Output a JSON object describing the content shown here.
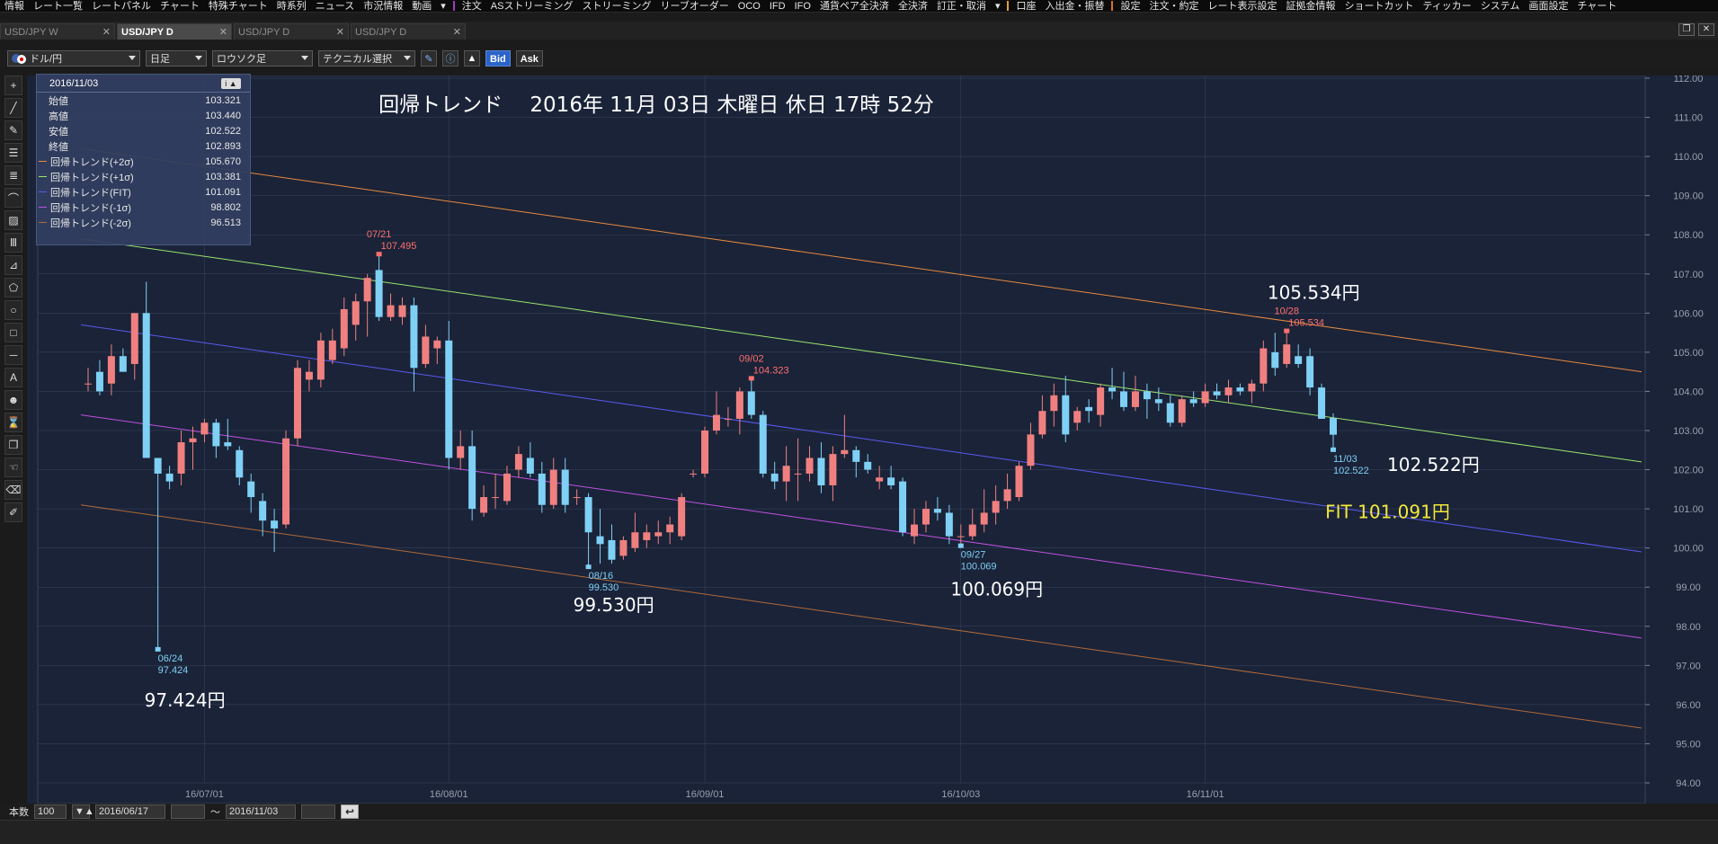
{
  "menu": {
    "items": [
      "情報",
      "レート一覧",
      "レートパネル",
      "チャート",
      "特殊チャート",
      "時系列",
      "ニュース",
      "市況情報",
      "動画",
      "▾",
      "注文",
      "ASストリーミング",
      "ストリーミング",
      "リーブオーダー",
      "OCO",
      "IFD",
      "IFO",
      "通貨ペア全決済",
      "全決済",
      "訂正・取消",
      "▾",
      "口座",
      "入出金・振替",
      "設定",
      "注文・約定",
      "レート表示設定",
      "証拠金情報",
      "ショートカット",
      "ティッカー",
      "システム",
      "画面設定",
      "チャート"
    ]
  },
  "tabs": [
    {
      "label": "USD/JPY W",
      "close": "✕"
    },
    {
      "label": "USD/JPY D",
      "close": "✕"
    },
    {
      "label": "USD/JPY D",
      "close": "✕"
    },
    {
      "label": "USD/JPY D",
      "close": "✕"
    }
  ],
  "toolbar": {
    "pair": "ドル/円",
    "period": "日足",
    "charttype": "ロウソク足",
    "technical": "テクニカル選択",
    "bid": "Bid",
    "ask": "Ask"
  },
  "tools": [
    "+",
    "╱",
    "✎",
    "☰",
    "≣",
    "⌒",
    "▨",
    "Ⅲ",
    "⊿",
    "⬠",
    "○",
    "□",
    "─",
    "A",
    "☻",
    "⌛",
    "❐",
    "☜",
    "⌫",
    "✐"
  ],
  "info_panel": {
    "date": "2016/11/03",
    "header_button": "i ▲",
    "rows": [
      {
        "label": "始値",
        "value": "103.321",
        "color": ""
      },
      {
        "label": "高値",
        "value": "103.440",
        "color": ""
      },
      {
        "label": "安値",
        "value": "102.522",
        "color": ""
      },
      {
        "label": "終値",
        "value": "102.893",
        "color": ""
      },
      {
        "label": "回帰トレンド(+2σ)",
        "value": "105.670",
        "color": "#e8893e"
      },
      {
        "label": "回帰トレンド(+1σ)",
        "value": "103.381",
        "color": "#9be36b"
      },
      {
        "label": "回帰トレンド(FIT)",
        "value": "101.091",
        "color": "#5a5af0"
      },
      {
        "label": "回帰トレンド(-1σ)",
        "value": "98.802",
        "color": "#c050e0"
      },
      {
        "label": "回帰トレンド(-2σ)",
        "value": "96.513",
        "color": "#b06a3a"
      }
    ]
  },
  "chart_data": {
    "type": "candlestick",
    "title": "回帰トレンド　 2016年 11月 03日 木曜日 休日 17時 52分",
    "y_ticks": [
      "112.00",
      "111.00",
      "110.00",
      "109.00",
      "108.00",
      "107.00",
      "106.00",
      "105.00",
      "104.00",
      "103.00",
      "102.00",
      "101.00",
      "100.00",
      "99.00",
      "98.00",
      "97.00",
      "96.00",
      "95.00",
      "94.00"
    ],
    "ylim": [
      94,
      112
    ],
    "x_ticks": [
      "16/07/01",
      "16/08/01",
      "16/09/01",
      "16/10/03",
      "16/11/01"
    ],
    "colors": {
      "up": "#f08080",
      "down": "#7fd0f5",
      "background": "#1a2338",
      "grid": "#3b465e",
      "axis_text": "#9aa0ad",
      "annotation_up": "#ff7070",
      "annotation_down": "#7fd0f5"
    },
    "candles": [
      [
        104.2,
        104.6,
        104.0,
        104.2
      ],
      [
        104.5,
        104.8,
        103.9,
        104.0
      ],
      [
        104.2,
        105.2,
        103.9,
        104.9
      ],
      [
        104.9,
        105.1,
        104.5,
        104.5
      ],
      [
        104.7,
        106.0,
        104.3,
        106.0
      ],
      [
        106.0,
        106.8,
        103.0,
        102.3
      ],
      [
        102.3,
        102.3,
        97.424,
        101.9
      ],
      [
        101.9,
        102.1,
        101.5,
        101.7
      ],
      [
        101.9,
        103.0,
        101.6,
        102.7
      ],
      [
        102.7,
        103.1,
        102.0,
        102.8
      ],
      [
        102.9,
        103.3,
        102.7,
        103.2
      ],
      [
        103.2,
        103.3,
        102.3,
        102.6
      ],
      [
        102.7,
        103.3,
        102.5,
        102.6
      ],
      [
        102.5,
        102.6,
        101.6,
        101.8
      ],
      [
        101.7,
        101.9,
        100.9,
        101.3
      ],
      [
        101.2,
        101.4,
        100.3,
        100.7
      ],
      [
        100.7,
        101.0,
        99.9,
        100.5
      ],
      [
        100.6,
        103.0,
        100.5,
        102.8
      ],
      [
        102.8,
        104.8,
        102.6,
        104.6
      ],
      [
        104.3,
        104.8,
        104.0,
        104.5
      ],
      [
        104.3,
        105.5,
        104.1,
        105.3
      ],
      [
        104.8,
        105.6,
        104.7,
        105.3
      ],
      [
        105.1,
        106.4,
        104.9,
        106.1
      ],
      [
        105.7,
        106.5,
        105.3,
        106.3
      ],
      [
        106.3,
        107.0,
        105.4,
        106.9
      ],
      [
        107.1,
        107.495,
        105.8,
        105.9
      ],
      [
        105.9,
        106.5,
        105.8,
        106.2
      ],
      [
        105.9,
        106.4,
        105.7,
        106.2
      ],
      [
        106.2,
        106.4,
        104.0,
        104.6
      ],
      [
        104.7,
        105.7,
        104.6,
        105.4
      ],
      [
        105.1,
        105.4,
        104.7,
        105.3
      ],
      [
        105.3,
        105.8,
        102.0,
        102.3
      ],
      [
        102.3,
        103.0,
        102.0,
        102.6
      ],
      [
        102.6,
        103.0,
        100.7,
        101.0
      ],
      [
        100.9,
        101.6,
        100.8,
        101.3
      ],
      [
        101.3,
        101.9,
        101.0,
        101.3
      ],
      [
        101.2,
        102.1,
        101.1,
        101.9
      ],
      [
        102.0,
        102.6,
        101.8,
        102.4
      ],
      [
        102.3,
        102.7,
        101.8,
        101.9
      ],
      [
        101.9,
        102.2,
        100.9,
        101.1
      ],
      [
        101.1,
        102.3,
        101.0,
        102.0
      ],
      [
        102.0,
        102.3,
        100.9,
        101.1
      ],
      [
        101.3,
        101.5,
        101.1,
        101.3
      ],
      [
        101.3,
        101.4,
        99.53,
        100.4
      ],
      [
        100.3,
        101.0,
        99.6,
        100.1
      ],
      [
        100.2,
        100.6,
        99.6,
        99.7
      ],
      [
        99.8,
        100.3,
        99.7,
        100.2
      ],
      [
        100.0,
        100.9,
        99.9,
        100.4
      ],
      [
        100.2,
        100.6,
        100.0,
        100.4
      ],
      [
        100.3,
        100.7,
        100.1,
        100.4
      ],
      [
        100.4,
        100.8,
        100.1,
        100.6
      ],
      [
        100.3,
        101.4,
        100.2,
        101.3
      ],
      [
        101.9,
        102.0,
        101.8,
        101.9
      ],
      [
        101.9,
        103.1,
        101.8,
        103.0
      ],
      [
        103.0,
        104.0,
        102.9,
        103.4
      ],
      [
        103.3,
        103.6,
        103.1,
        103.3
      ],
      [
        103.3,
        104.1,
        102.9,
        104.0
      ],
      [
        104.0,
        104.323,
        103.3,
        103.4
      ],
      [
        103.4,
        103.5,
        101.8,
        101.9
      ],
      [
        101.9,
        102.2,
        101.5,
        101.7
      ],
      [
        101.7,
        102.6,
        101.2,
        102.1
      ],
      [
        101.9,
        102.8,
        101.2,
        101.9
      ],
      [
        101.9,
        102.6,
        101.7,
        102.3
      ],
      [
        102.3,
        102.7,
        101.4,
        101.6
      ],
      [
        101.6,
        102.6,
        101.2,
        102.4
      ],
      [
        102.4,
        103.4,
        102.3,
        102.5
      ],
      [
        102.5,
        102.6,
        101.8,
        102.2
      ],
      [
        102.2,
        102.4,
        101.9,
        102.0
      ],
      [
        101.7,
        102.1,
        101.5,
        101.8
      ],
      [
        101.8,
        102.1,
        101.5,
        101.6
      ],
      [
        101.7,
        101.8,
        100.3,
        100.4
      ],
      [
        100.3,
        101.0,
        100.1,
        100.6
      ],
      [
        100.6,
        101.2,
        100.4,
        101.0
      ],
      [
        101.0,
        101.3,
        100.7,
        100.9
      ],
      [
        100.9,
        101.1,
        100.1,
        100.3
      ],
      [
        100.3,
        100.6,
        100.069,
        100.3
      ],
      [
        100.3,
        101.0,
        100.2,
        100.6
      ],
      [
        100.6,
        101.5,
        100.4,
        100.9
      ],
      [
        100.9,
        101.6,
        100.6,
        101.2
      ],
      [
        101.2,
        101.9,
        101.0,
        101.5
      ],
      [
        101.3,
        102.2,
        101.2,
        102.1
      ],
      [
        102.1,
        103.2,
        102.0,
        102.9
      ],
      [
        102.9,
        103.9,
        102.8,
        103.5
      ],
      [
        103.5,
        104.2,
        103.1,
        103.9
      ],
      [
        103.9,
        104.4,
        102.7,
        102.9
      ],
      [
        103.2,
        103.6,
        103.0,
        103.5
      ],
      [
        103.6,
        103.8,
        103.2,
        103.5
      ],
      [
        103.4,
        104.2,
        103.1,
        104.1
      ],
      [
        104.1,
        104.6,
        103.8,
        104.0
      ],
      [
        104.0,
        104.5,
        103.5,
        103.6
      ],
      [
        103.6,
        104.4,
        103.5,
        104.0
      ],
      [
        104.0,
        104.2,
        103.3,
        103.8
      ],
      [
        103.8,
        104.1,
        103.5,
        103.7
      ],
      [
        103.7,
        103.9,
        103.1,
        103.2
      ],
      [
        103.2,
        103.9,
        103.1,
        103.8
      ],
      [
        103.8,
        104.0,
        103.6,
        103.7
      ],
      [
        103.7,
        104.2,
        103.6,
        104.0
      ],
      [
        104.0,
        104.2,
        103.8,
        103.9
      ],
      [
        103.9,
        104.3,
        103.7,
        104.1
      ],
      [
        104.1,
        104.2,
        103.9,
        104.0
      ],
      [
        104.0,
        104.3,
        103.7,
        104.2
      ],
      [
        104.2,
        105.3,
        104.0,
        105.1
      ],
      [
        105.0,
        105.5,
        104.4,
        104.6
      ],
      [
        104.7,
        105.534,
        104.6,
        105.2
      ],
      [
        104.9,
        105.2,
        104.6,
        104.7
      ],
      [
        104.9,
        105.1,
        103.9,
        104.1
      ],
      [
        104.1,
        104.2,
        103.3,
        103.3
      ],
      [
        103.321,
        103.44,
        102.522,
        102.893
      ]
    ],
    "regression_lines": [
      {
        "name": "+2σ",
        "color": "#e8893e",
        "start": 110.2,
        "end": 104.5
      },
      {
        "name": "+1σ",
        "color": "#9be36b",
        "start": 107.9,
        "end": 102.2
      },
      {
        "name": "FIT",
        "color": "#5a5af0",
        "start": 105.7,
        "end": 99.9
      },
      {
        "name": "-1σ",
        "color": "#c050e0",
        "start": 103.4,
        "end": 97.7
      },
      {
        "name": "-2σ",
        "color": "#b06a3a",
        "start": 101.1,
        "end": 95.4
      }
    ],
    "annotations": [
      {
        "candle": 25,
        "date": "07/21",
        "value": "107.495",
        "kind": "high"
      },
      {
        "candle": 57,
        "date": "09/02",
        "value": "104.323",
        "kind": "high"
      },
      {
        "candle": 103,
        "date": "10/28",
        "value": "105.534",
        "kind": "high"
      },
      {
        "candle": 6,
        "date": "06/24",
        "value": "97.424",
        "kind": "low"
      },
      {
        "candle": 43,
        "date": "08/16",
        "value": "99.530",
        "kind": "low"
      },
      {
        "candle": 75,
        "date": "09/27",
        "value": "100.069",
        "kind": "low"
      },
      {
        "candle": 107,
        "date": "11/03",
        "value": "102.522",
        "kind": "low"
      }
    ],
    "big_labels": [
      {
        "text": "105.534円",
        "anchor": "high-10/28",
        "color": "#ffffff"
      },
      {
        "text": "102.522円",
        "anchor": "low-11/03",
        "color": "#ffffff"
      },
      {
        "text": "FIT 101.091円",
        "anchor": "fit",
        "color": "#f3e83b"
      },
      {
        "text": "97.424円",
        "anchor": "low-06/24",
        "color": "#ffffff"
      },
      {
        "text": "99.530円",
        "anchor": "low-08/16",
        "color": "#ffffff"
      },
      {
        "text": "100.069円",
        "anchor": "low-09/27",
        "color": "#ffffff"
      }
    ]
  },
  "bottom": {
    "count_label": "本数",
    "count_value": "100",
    "count_buttons": "▼▲",
    "start_date": "2016/06/17",
    "tilde": "～",
    "end_date": "2016/11/03",
    "reset_button": "↩"
  }
}
